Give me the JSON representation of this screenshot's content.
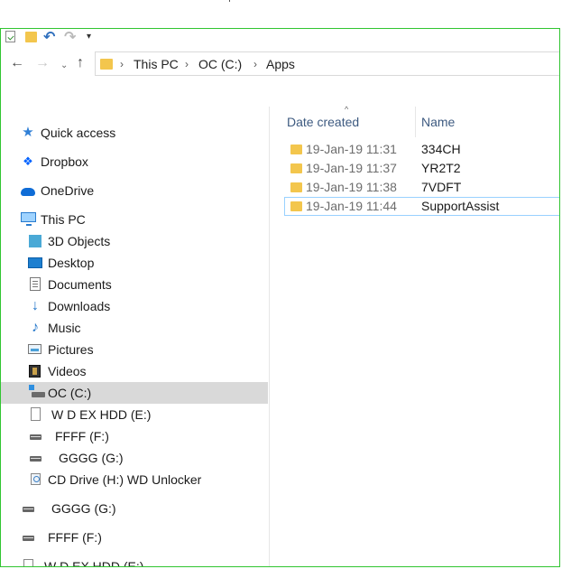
{
  "quick_access_toolbar": {
    "icons": [
      "properties-icon",
      "new-folder-icon",
      "undo-icon",
      "redo-icon",
      "customize-icon"
    ]
  },
  "address_bar": {
    "segments": [
      "This PC",
      "OC  (C:)",
      "Apps"
    ]
  },
  "nav_pane": {
    "items": [
      {
        "label": "Quick access",
        "icon": "star-icon"
      },
      {
        "label": "Dropbox",
        "icon": "dropbox-icon"
      },
      {
        "label": "OneDrive",
        "icon": "cloud-icon"
      },
      {
        "label": "This PC",
        "icon": "computer-icon"
      },
      {
        "label": "3D Objects",
        "icon": "cube-icon"
      },
      {
        "label": "Desktop",
        "icon": "desktop-icon"
      },
      {
        "label": "Documents",
        "icon": "document-icon"
      },
      {
        "label": "Downloads",
        "icon": "download-icon"
      },
      {
        "label": "Music",
        "icon": "music-icon"
      },
      {
        "label": "Pictures",
        "icon": "pictures-icon"
      },
      {
        "label": "Videos",
        "icon": "video-icon"
      },
      {
        "label": "OC  (C:)",
        "icon": "system-drive-icon",
        "selected": true
      },
      {
        "label": "W D EX HDD  (E:)",
        "icon": "drive-icon"
      },
      {
        "label": "FFFF (F:)",
        "icon": "drive-icon"
      },
      {
        "label": "GGGG (G:)",
        "icon": "drive-icon"
      },
      {
        "label": "CD Drive (H:) WD Unlocker",
        "icon": "cd-drive-icon"
      },
      {
        "label": "GGGG (G:)",
        "icon": "drive-icon"
      },
      {
        "label": "FFFF (F:)",
        "icon": "drive-icon"
      },
      {
        "label": "W D EX HDD  (E:)",
        "icon": "drive-icon"
      }
    ]
  },
  "file_list": {
    "columns": [
      "Date created",
      "Name"
    ],
    "rows": [
      {
        "date": "19-Jan-19 11:31",
        "name": "334CH"
      },
      {
        "date": "19-Jan-19 11:37",
        "name": "YR2T2"
      },
      {
        "date": "19-Jan-19 11:38",
        "name": "7VDFT"
      },
      {
        "date": "19-Jan-19 11:44",
        "name": "SupportAssist",
        "focused": true
      }
    ]
  },
  "colors": {
    "frame_border": "#31c531",
    "folder": "#f3c64d",
    "selection": "#d9d9d9",
    "focus_outline": "#99d1ff",
    "header_text": "#3d5a80"
  }
}
